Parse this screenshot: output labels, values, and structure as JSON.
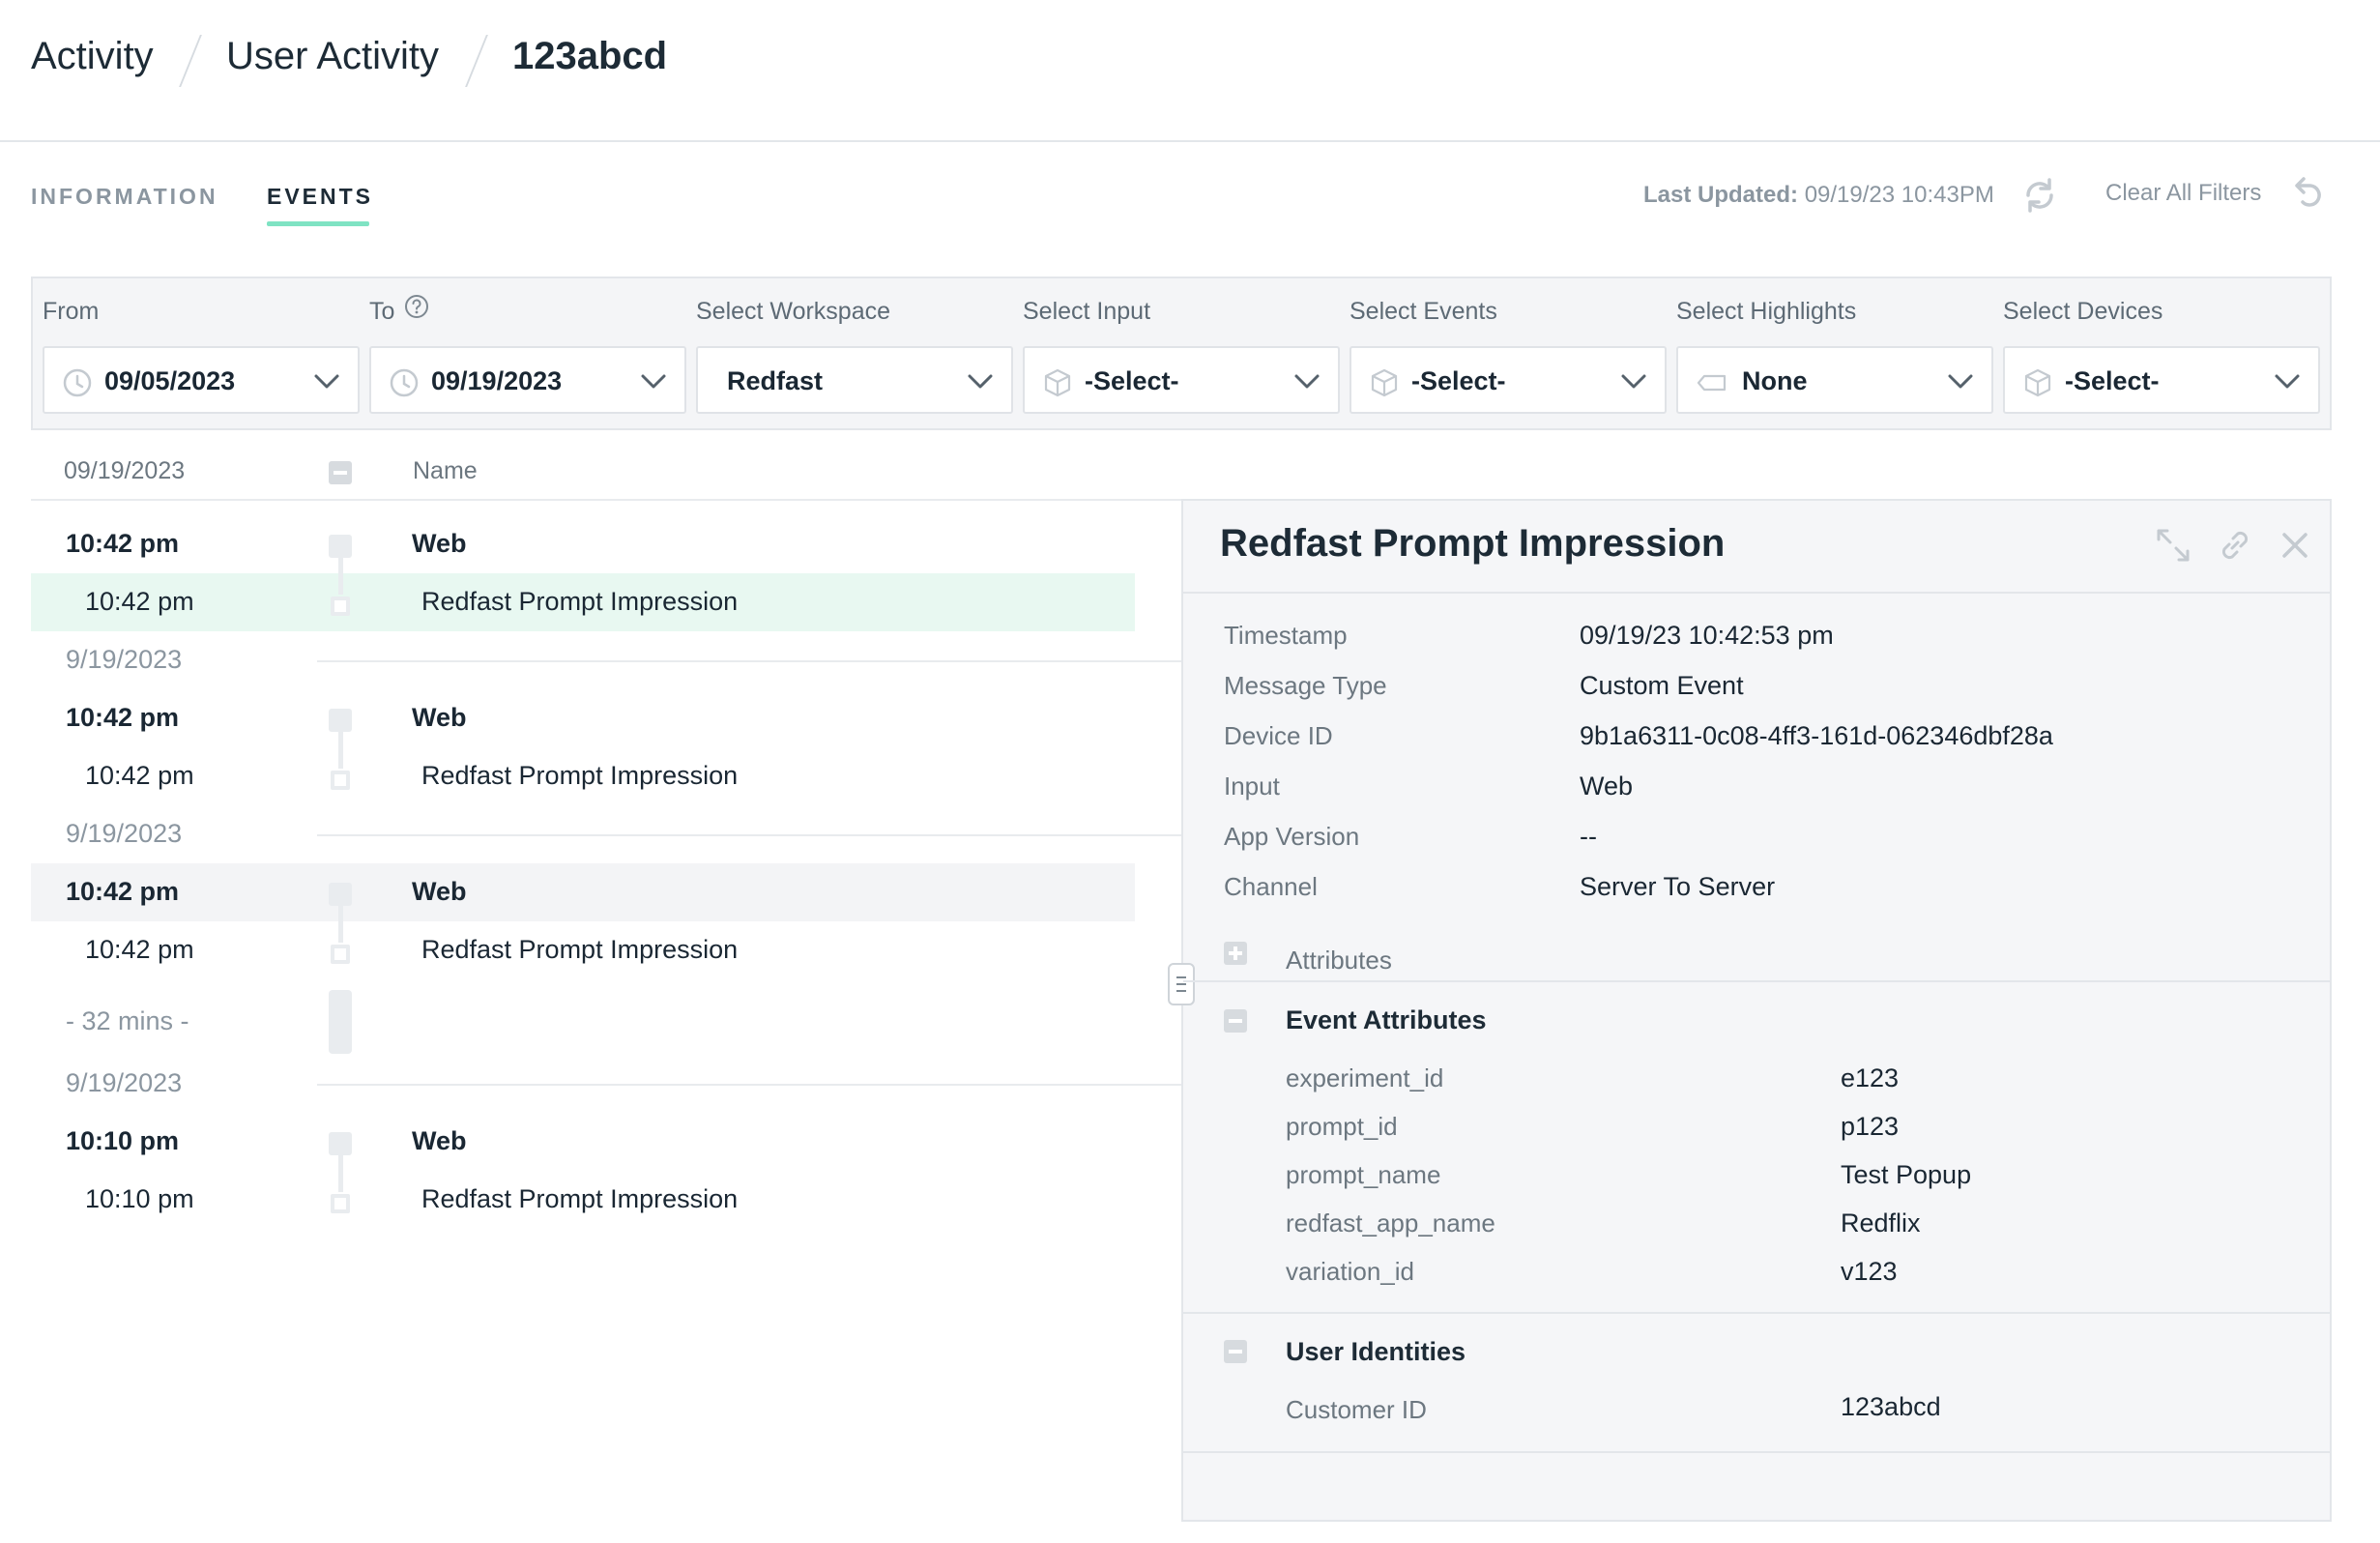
{
  "breadcrumb": {
    "items": [
      "Activity",
      "User Activity"
    ],
    "current": "123abcd"
  },
  "tabs": [
    {
      "label": "INFORMATION",
      "active": false
    },
    {
      "label": "EVENTS",
      "active": true
    }
  ],
  "toolbar": {
    "last_updated_label": "Last Updated:",
    "last_updated_value": "09/19/23 10:43PM",
    "clear_filters_label": "Clear All Filters"
  },
  "filters": {
    "from": {
      "label": "From",
      "value": "09/05/2023"
    },
    "to": {
      "label": "To",
      "value": "09/19/2023"
    },
    "workspace": {
      "label": "Select Workspace",
      "value": "Redfast"
    },
    "input": {
      "label": "Select Input",
      "value": "-Select-"
    },
    "events": {
      "label": "Select Events",
      "value": "-Select-"
    },
    "highlights": {
      "label": "Select Highlights",
      "value": "None"
    },
    "devices": {
      "label": "Select Devices",
      "value": "-Select-"
    }
  },
  "list": {
    "header_date": "09/19/2023",
    "header_name": "Name",
    "gap_label": "- 32 mins -",
    "groups": [
      {
        "date": "",
        "group_time": "10:42 pm",
        "group_name": "Web",
        "event_time": "10:42 pm",
        "event_name": "Redfast Prompt Impression"
      },
      {
        "date": "9/19/2023",
        "group_time": "10:42 pm",
        "group_name": "Web",
        "event_time": "10:42 pm",
        "event_name": "Redfast Prompt Impression"
      },
      {
        "date": "9/19/2023",
        "group_time": "10:42 pm",
        "group_name": "Web",
        "event_time": "10:42 pm",
        "event_name": "Redfast Prompt Impression"
      },
      {
        "date": "9/19/2023",
        "group_time": "10:10 pm",
        "group_name": "Web",
        "event_time": "10:10 pm",
        "event_name": "Redfast Prompt Impression"
      }
    ]
  },
  "detail": {
    "title": "Redfast Prompt Impression",
    "fields": [
      {
        "label": "Timestamp",
        "value": "09/19/23 10:42:53 pm"
      },
      {
        "label": "Message Type",
        "value": "Custom Event"
      },
      {
        "label": "Device ID",
        "value": "9b1a6311-0c08-4ff3-161d-062346dbf28a"
      },
      {
        "label": "Input",
        "value": "Web"
      },
      {
        "label": "App Version",
        "value": "--"
      },
      {
        "label": "Channel",
        "value": "Server To Server"
      }
    ],
    "attributes_label": "Attributes",
    "event_attributes": {
      "title": "Event Attributes",
      "items": [
        {
          "key": "experiment_id",
          "value": "e123"
        },
        {
          "key": "prompt_id",
          "value": "p123"
        },
        {
          "key": "prompt_name",
          "value": "Test Popup"
        },
        {
          "key": "redfast_app_name",
          "value": "Redflix"
        },
        {
          "key": "variation_id",
          "value": "v123"
        }
      ]
    },
    "user_identities": {
      "title": "User Identities",
      "items": [
        {
          "key": "Customer ID",
          "value": "123abcd"
        }
      ]
    }
  },
  "colors": {
    "accent": "#7fe3c3",
    "selected_row": "#e8f8f1",
    "hover_row": "#f3f4f6",
    "panel_bg": "#f5f6f8"
  },
  "icons": [
    "help-circle-icon",
    "refresh-icon",
    "undo-icon",
    "clock-icon",
    "cube-icon",
    "tag-icon",
    "chevron-down-icon",
    "expand-icon",
    "link-icon",
    "close-icon",
    "drag-handle-icon"
  ]
}
